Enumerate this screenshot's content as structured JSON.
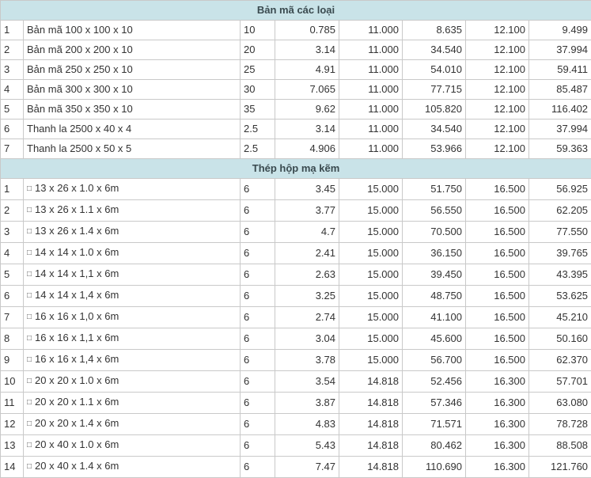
{
  "sections": [
    {
      "title": "Bản mã các loại",
      "rows": [
        [
          "1",
          "",
          "Bản mã 100 x 100 x 10",
          "10",
          "0.785",
          "11.000",
          "8.635",
          "12.100",
          "9.499"
        ],
        [
          "2",
          "",
          "Bản mã 200 x 200 x 10",
          "20",
          "3.14",
          "11.000",
          "34.540",
          "12.100",
          "37.994"
        ],
        [
          "3",
          "",
          "Bản mã 250 x 250 x 10",
          "25",
          "4.91",
          "11.000",
          "54.010",
          "12.100",
          "59.411"
        ],
        [
          "4",
          "",
          "Bản mã 300 x 300 x 10",
          "30",
          "7.065",
          "11.000",
          "77.715",
          "12.100",
          "85.487"
        ],
        [
          "5",
          "",
          "Bản mã 350 x 350 x 10",
          "35",
          "9.62",
          "11.000",
          "105.820",
          "12.100",
          "116.402"
        ],
        [
          "6",
          "",
          "Thanh la 2500 x 40 x 4",
          "2.5",
          "3.14",
          "11.000",
          "34.540",
          "12.100",
          "37.994"
        ],
        [
          "7",
          "",
          "Thanh la 2500 x 50 x 5",
          "2.5",
          "4.906",
          "11.000",
          "53.966",
          "12.100",
          "59.363"
        ]
      ]
    },
    {
      "title": "Thép hộp mạ kẽm",
      "rows": [
        [
          "1",
          "□",
          "13 x 26 x 1.0 x 6m",
          "6",
          "3.45",
          "15.000",
          "51.750",
          "16.500",
          "56.925"
        ],
        [
          "2",
          "□",
          "13 x 26 x 1.1 x 6m",
          "6",
          "3.77",
          "15.000",
          "56.550",
          "16.500",
          "62.205"
        ],
        [
          "3",
          "□",
          "13 x 26 x 1.4 x 6m",
          "6",
          "4.7",
          "15.000",
          "70.500",
          "16.500",
          "77.550"
        ],
        [
          "4",
          "□",
          "14 x 14 x 1.0 x 6m",
          "6",
          "2.41",
          "15.000",
          "36.150",
          "16.500",
          "39.765"
        ],
        [
          "5",
          "□",
          "14 x 14 x 1,1 x 6m",
          "6",
          "2.63",
          "15.000",
          "39.450",
          "16.500",
          "43.395"
        ],
        [
          "6",
          "□",
          "14 x 14 x 1,4 x 6m",
          "6",
          "3.25",
          "15.000",
          "48.750",
          "16.500",
          "53.625"
        ],
        [
          "7",
          "□",
          "16 x 16 x 1,0 x 6m",
          "6",
          "2.74",
          "15.000",
          "41.100",
          "16.500",
          "45.210"
        ],
        [
          "8",
          "□",
          "16 x 16 x 1,1 x 6m",
          "6",
          "3.04",
          "15.000",
          "45.600",
          "16.500",
          "50.160"
        ],
        [
          "9",
          "□",
          "16 x 16 x 1,4 x 6m",
          "6",
          "3.78",
          "15.000",
          "56.700",
          "16.500",
          "62.370"
        ],
        [
          "10",
          "□",
          "20 x 20 x 1.0 x 6m",
          "6",
          "3.54",
          "14.818",
          "52.456",
          "16.300",
          "57.701"
        ],
        [
          "11",
          "□",
          "20 x 20 x 1.1 x 6m",
          "6",
          "3.87",
          "14.818",
          "57.346",
          "16.300",
          "63.080"
        ],
        [
          "12",
          "□",
          "20 x 20 x 1.4 x 6m",
          "6",
          "4.83",
          "14.818",
          "71.571",
          "16.300",
          "78.728"
        ],
        [
          "13",
          "□",
          "20 x 40 x 1.0 x 6m",
          "6",
          "5.43",
          "14.818",
          "80.462",
          "16.300",
          "88.508"
        ],
        [
          "14",
          "□",
          "20 x 40 x 1.4 x 6m",
          "6",
          "7.47",
          "14.818",
          "110.690",
          "16.300",
          "121.760"
        ]
      ]
    }
  ]
}
